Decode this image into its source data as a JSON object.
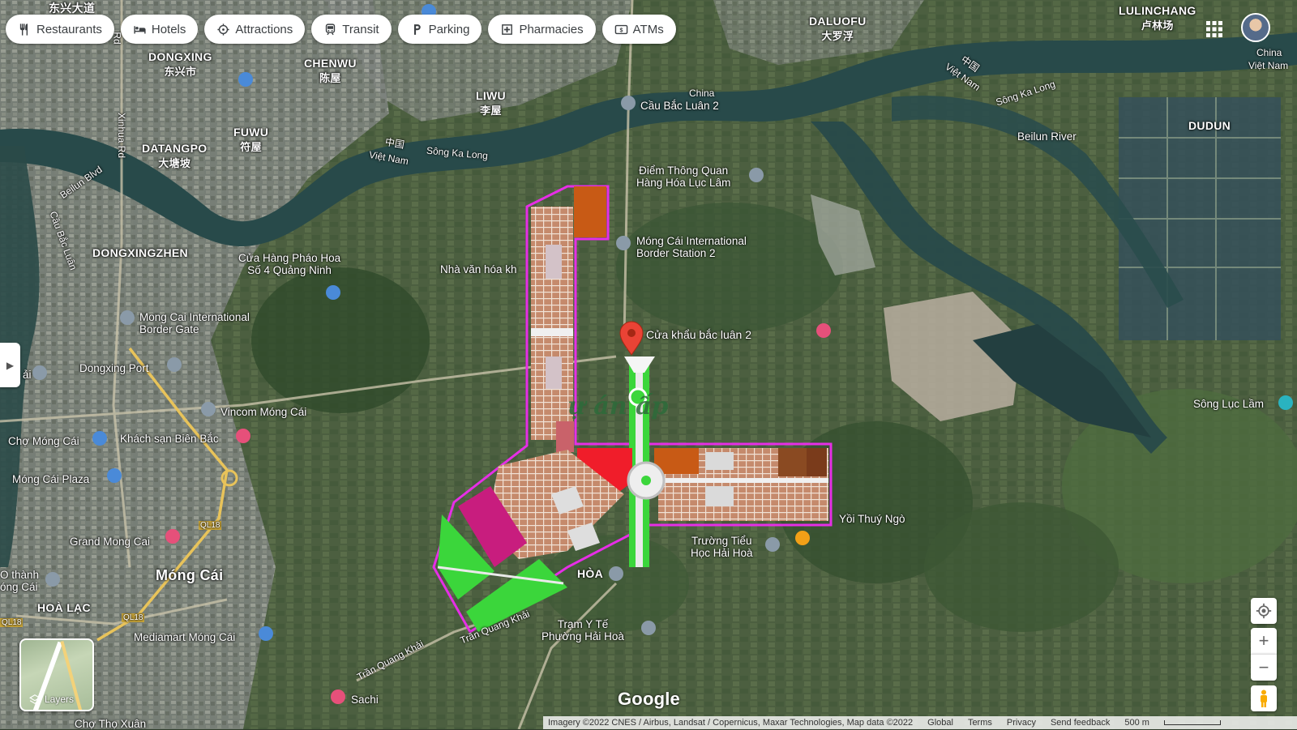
{
  "filters": [
    {
      "label": "Restaurants",
      "icon": "fork-knife-icon"
    },
    {
      "label": "Hotels",
      "icon": "bed-icon"
    },
    {
      "label": "Attractions",
      "icon": "attraction-icon"
    },
    {
      "label": "Transit",
      "icon": "train-icon"
    },
    {
      "label": "Parking",
      "icon": "parking-icon"
    },
    {
      "label": "Pharmacies",
      "icon": "pharmacy-icon"
    },
    {
      "label": "ATMs",
      "icon": "atm-icon"
    }
  ],
  "places": {
    "dongxingroad": "东兴大道",
    "dongxing": "DONGXING",
    "dongxing_cn": "东兴市",
    "chenwu": "CHENWU",
    "chenwu_cn": "陈屋",
    "liwu": "LIWU",
    "liwu_cn": "李屋",
    "fuwu": "FUWU",
    "fuwu_cn": "符屋",
    "datangpo": "DATANGPO",
    "datangpo_cn": "大塘坡",
    "daluofu": "DALUOFU",
    "daluofu_cn": "大罗浮",
    "lulinchang": "LULINCHANG",
    "lulinchang_cn": "卢林场",
    "dudun": "DUDUN",
    "dongxingzhen": "DONGXINGZHEN",
    "mongcai": "Móng Cái",
    "hoalac": "HOÀ LẠC",
    "hoa": "HÒA"
  },
  "roads": {
    "xinhua": "Xinhua Rd",
    "beilun_blvd": "Beilun Blvd",
    "cau_bac_luan": "Cầu Bắc Luân",
    "song_ka_long_w": "Sông Ka Long",
    "song_ka_long_e": "Sông Ka Long",
    "tran_quang_khai": "Trần Quang Khải",
    "tran_quang_khai2": "Trần Quang Khải",
    "ql18a": "QL18",
    "ql18b": "QL18",
    "ql18c": "QL18",
    "ql18d": "QL18",
    "tst": "Rd",
    "china_w": "China",
    "viet_w": "Việt Nam",
    "cn_w": "中国",
    "cn_e": "中国",
    "viet_e": "Việt Nam",
    "china_e": "China",
    "china_ne": "China",
    "viet_ne": "Việt Nam",
    "beilun_river": "Beilun River",
    "song_luc_lam": "Sông Lục Lầm"
  },
  "pois": {
    "cau_bac_luan_2": "Cầu Bắc Luân 2",
    "diem_thong_quan": "Điểm Thông Quan\nHàng Hóa Lục Lâm",
    "border_station_2": "Móng Cái International\nBorder Station 2",
    "cua_hang_phao_hoa": "Cửa Hàng Pháo Hoa\nSố 4 Quảng Ninh",
    "nha_van_hoa": "Nhà văn hóa kh",
    "border_gate": "Mong Cai International\nBorder Gate",
    "dongxing_port": "Dongxing Port",
    "vincom": "Vincom Móng Cái",
    "khach_san": "Khách sạn Biên Bắc",
    "cho_mong_cai": "Chợ Móng Cái",
    "mong_cai_plaza": "Móng Cái Plaza",
    "grand_mong_cai": "Grand Mong Cai",
    "o_thanh": "O thành\nóng Cái",
    "mediamart": "Mediamart Móng Cái",
    "sachi": "Sachi",
    "cho_tho_xuan": "Chợ Thọ Xuân",
    "truong_tieu_hoc": "Trường Tiểu\nHọc Hải Hoà",
    "tram_y_te": "Trạm Y Tế\nPhường Hải Hoà",
    "yoi_thuy_ngo": "Yồi Thuý Ngò",
    "ai": "ải"
  },
  "pin": {
    "label": "Cửa khẩu bắc luân 2",
    "color": "#ea4335"
  },
  "overlay_text": "ự án ấp",
  "layers_label": "Layers",
  "google": "Google",
  "footer": {
    "imagery": "Imagery ©2022 CNES / Airbus, Landsat / Copernicus, Maxar Technologies, Map data ©2022",
    "global": "Global",
    "terms": "Terms",
    "privacy": "Privacy",
    "feedback": "Send feedback",
    "scale": "500 m"
  },
  "colors": {
    "pink_zone": "#c81d7e",
    "green_zone": "#3bd63b",
    "red_zone": "#f01d2a",
    "orange_zone": "#c85a15",
    "residential": "#b87a62",
    "boundary": "#e62ee6"
  }
}
